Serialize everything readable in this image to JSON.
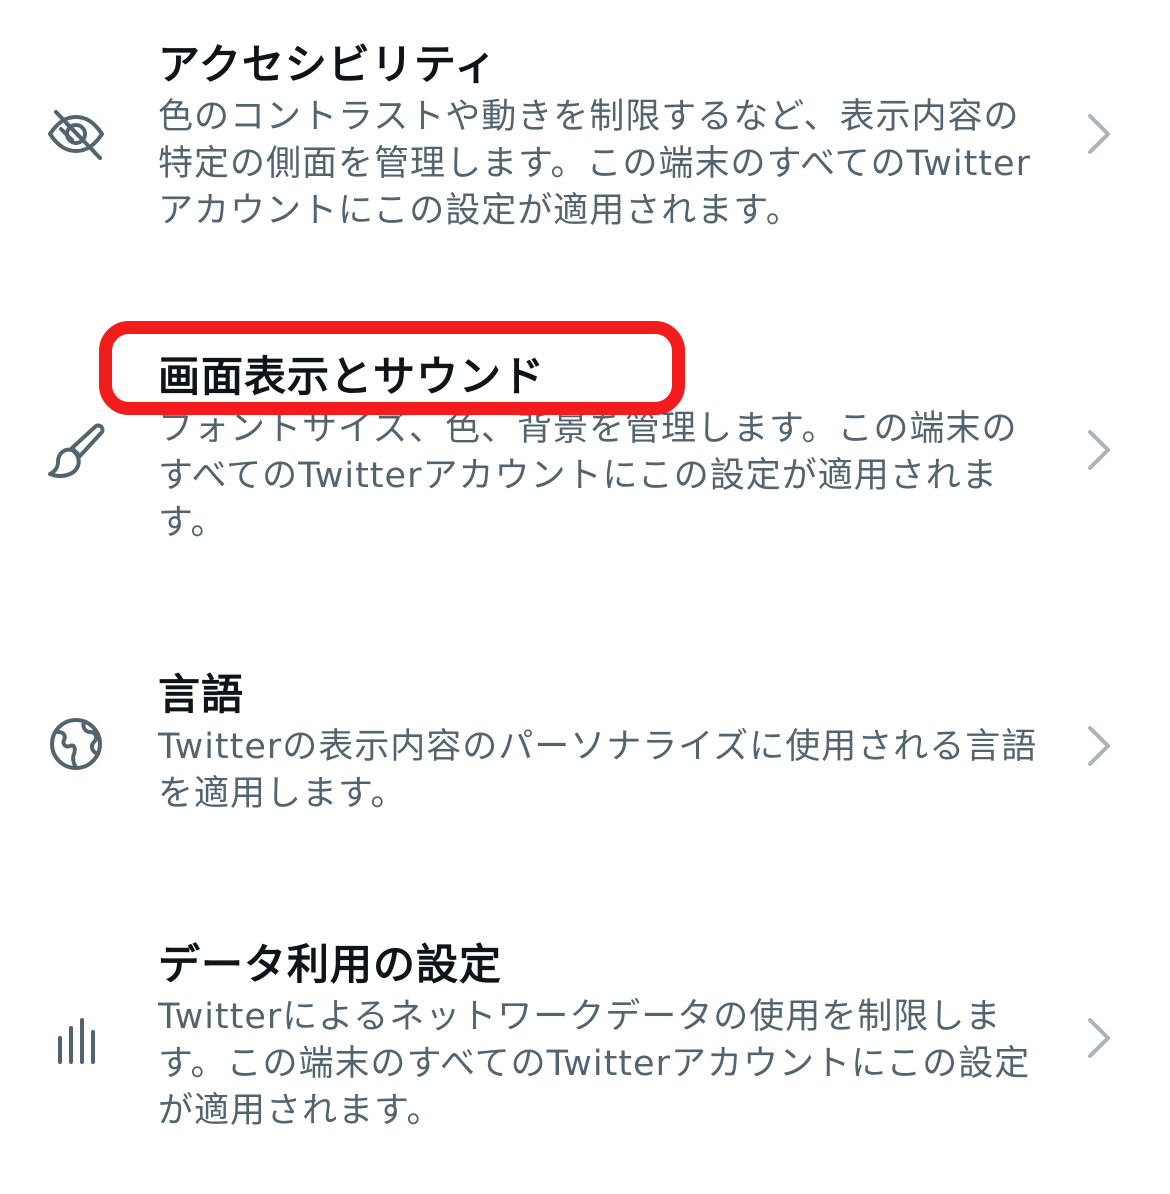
{
  "settings": {
    "items": [
      {
        "title": "アクセシビリティ",
        "description": "色のコントラストや動きを制限するなど、表示内容の特定の側面を管理します。この端末のすべてのTwitterアカウントにこの設定が適用されます。",
        "icon": "accessibility-eye-slash-icon"
      },
      {
        "title": "画面表示とサウンド",
        "description": "フォントサイズ、色、背景を管理します。この端末のすべてのTwitterアカウントにこの設定が適用されます。",
        "icon": "paintbrush-icon"
      },
      {
        "title": "言語",
        "description": "Twitterの表示内容のパーソナライズに使用される言語を適用します。",
        "icon": "globe-icon"
      },
      {
        "title": "データ利用の設定",
        "description": "Twitterによるネットワークデータの使用を制限します。この端末のすべてのTwitterアカウントにこの設定が適用されます。",
        "icon": "data-usage-bars-icon"
      }
    ],
    "chevron_icon": "chevron-right-icon"
  },
  "colors": {
    "title": "#0f1419",
    "description": "#536471",
    "icon": "#536471",
    "chevron": "#a9b4bd",
    "highlight": "#f21c1c"
  }
}
